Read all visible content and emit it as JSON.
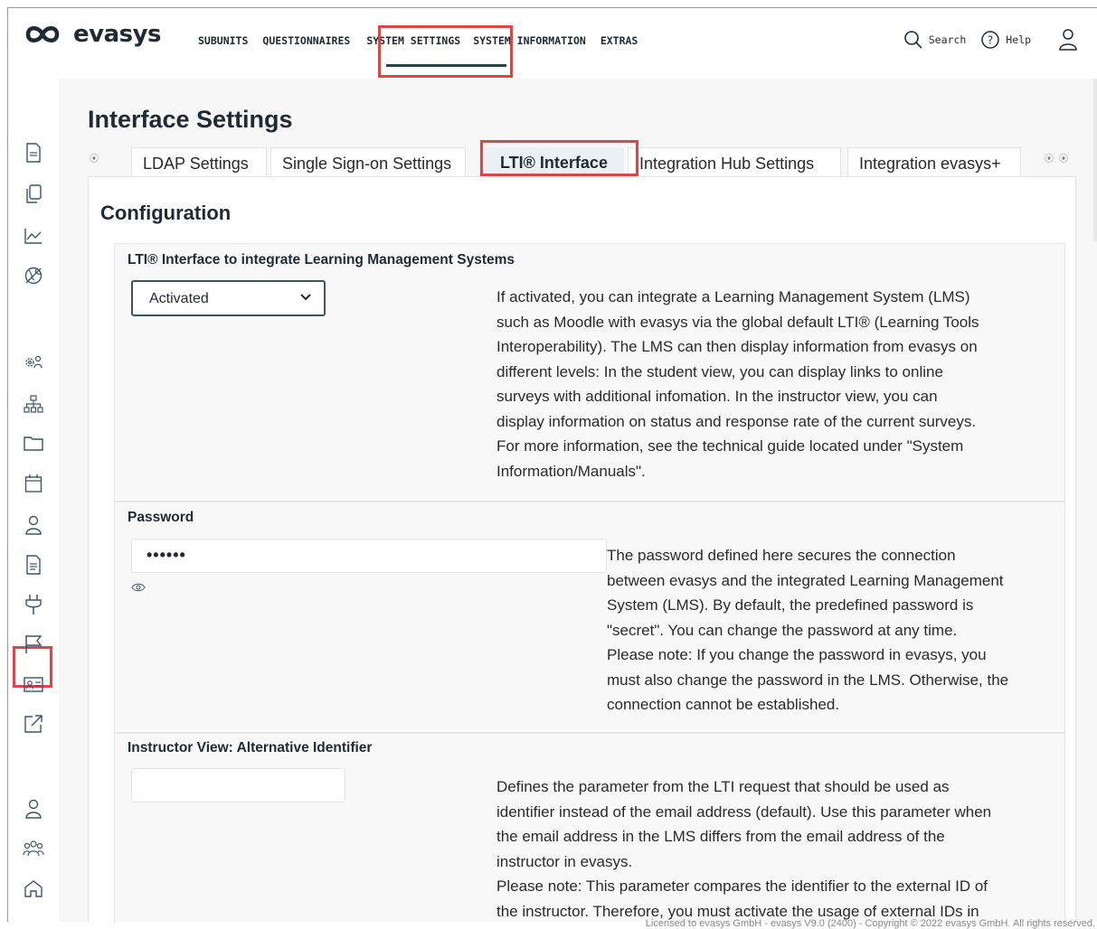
{
  "app": {
    "name": "evasys"
  },
  "nav": {
    "items": [
      "SUBUNITS",
      "QUESTIONNAIRES",
      "SYSTEM SETTINGS",
      "SYSTEM INFORMATION",
      "EXTRAS"
    ],
    "active": "SYSTEM SETTINGS",
    "search_label": "Search",
    "help_label": "Help"
  },
  "page": {
    "title": "Interface Settings"
  },
  "tabs": {
    "items": [
      "LDAP Settings",
      "Single Sign-on Settings",
      "LTI® Interface",
      "Integration Hub Settings",
      "Integration evasys+"
    ],
    "active": "LTI® Interface"
  },
  "section": {
    "title": "Configuration"
  },
  "lti": {
    "label": "LTI® Interface to integrate Learning Management Systems",
    "value": "Activated",
    "description_lines": [
      "If activated, you can integrate a Learning Management System (LMS)",
      "such as Moodle with evasys via the global default LTI® (Learning Tools",
      "Interoperability). The LMS can then display information from evasys on",
      "different levels: In the student view, you can display links to online",
      "surveys with additional infomation. In the instructor view, you can",
      "display information on status and response rate of the current surveys.",
      "For more information, see the technical guide located under \"System",
      "Information/Manuals\"."
    ]
  },
  "password": {
    "label": "Password",
    "value": "••••••",
    "description_lines": [
      "The password defined here secures the connection",
      "between evasys and the integrated Learning Management",
      "System (LMS). By default, the predefined password is",
      "\"secret\". You can change the password at any time.",
      "Please note: If you change the password in evasys, you",
      "must also change the password in the LMS. Otherwise, the",
      "connection cannot be established."
    ]
  },
  "alt_identifier": {
    "label": "Instructor View: Alternative Identifier",
    "value": "",
    "description_lines": [
      "Defines the parameter from the LTI request that should be used as",
      "identifier instead of the email address (default). Use this parameter when",
      "the email address in the LMS differs from the email address of the",
      "instructor in evasys.",
      "Please note: This parameter compares the identifier to the external ID of",
      "the instructor. Therefore, you must activate the usage of external IDs in"
    ]
  },
  "footer": {
    "text": "Licensed to evasys GmbH - evasys V9.0 (2400) - Copyright © 2022 evasys GmbH. All rights reserved."
  },
  "colors": {
    "accent": "#1f2a33",
    "highlight": "#e04444",
    "active_tab_bg": "#eaf0f3"
  },
  "sidebar_icons": [
    "document-icon",
    "copy-icon",
    "chart-icon",
    "globe-off-icon",
    "settings-users-icon",
    "hierarchy-icon",
    "folder-icon",
    "calendar-icon",
    "user-icon",
    "report-icon",
    "plug-icon",
    "flag-icon",
    "id-card-icon",
    "external-link-icon",
    "profile-icon",
    "group-icon",
    "home-icon"
  ]
}
